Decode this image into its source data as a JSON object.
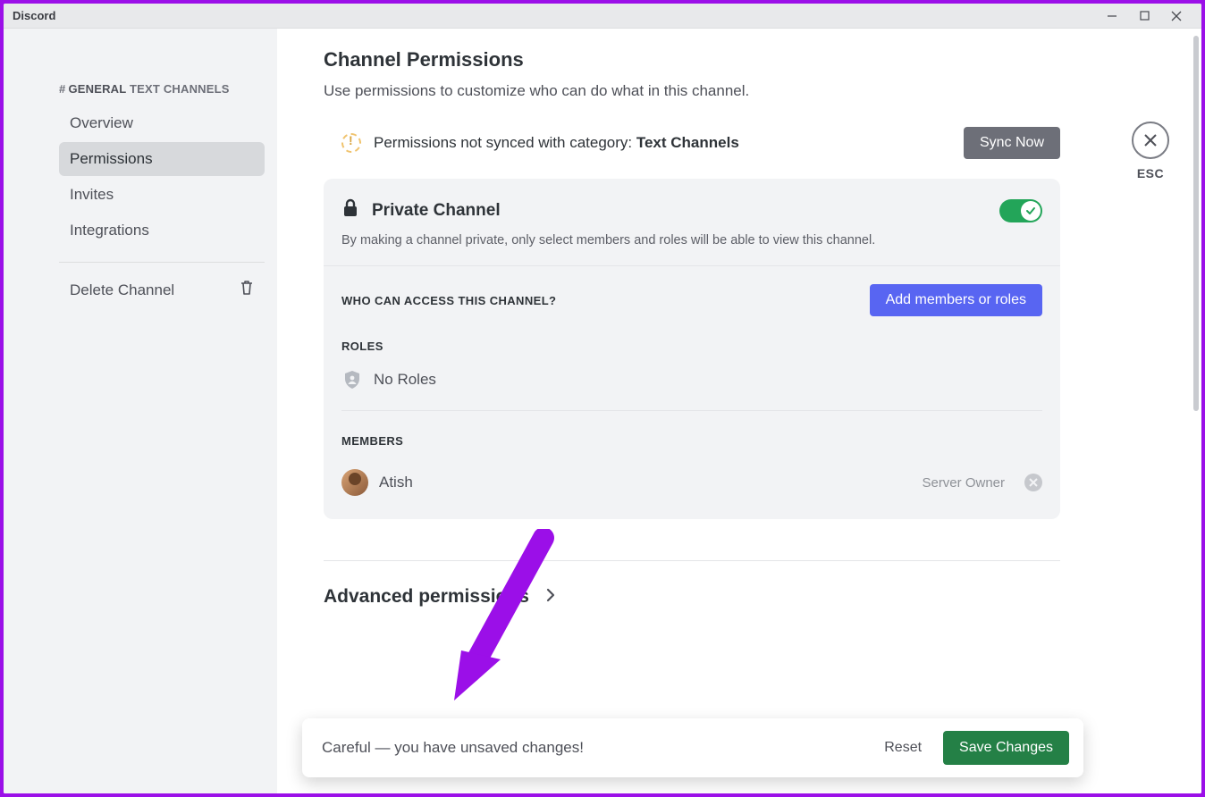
{
  "window": {
    "title": "Discord"
  },
  "sidebar": {
    "channel_prefix": "#",
    "channel_name": "GENERAL",
    "channel_label": "TEXT CHANNELS",
    "items": [
      {
        "label": "Overview",
        "active": false
      },
      {
        "label": "Permissions",
        "active": true
      },
      {
        "label": "Invites",
        "active": false
      },
      {
        "label": "Integrations",
        "active": false
      }
    ],
    "delete_label": "Delete Channel"
  },
  "esc": {
    "label": "ESC"
  },
  "page": {
    "title": "Channel Permissions",
    "description": "Use permissions to customize who can do what in this channel."
  },
  "sync": {
    "text_prefix": "Permissions not synced with category: ",
    "category": "Text Channels",
    "button": "Sync Now"
  },
  "private": {
    "title": "Private Channel",
    "description": "By making a channel private, only select members and roles will be able to view this channel.",
    "enabled": true
  },
  "access": {
    "heading": "WHO CAN ACCESS THIS CHANNEL?",
    "add_button": "Add members or roles",
    "roles_heading": "ROLES",
    "no_roles": "No Roles",
    "members_heading": "MEMBERS",
    "members": [
      {
        "name": "Atish",
        "tag": "Server Owner"
      }
    ]
  },
  "advanced": {
    "label": "Advanced permissions"
  },
  "unsaved": {
    "text": "Careful — you have unsaved changes!",
    "reset": "Reset",
    "save": "Save Changes"
  }
}
